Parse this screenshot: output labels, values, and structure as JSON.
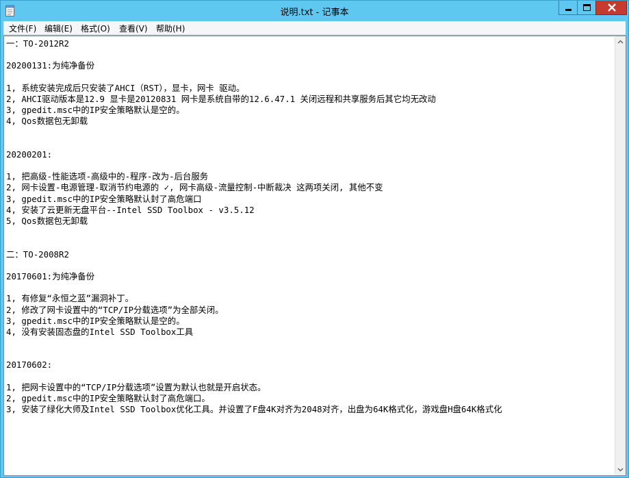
{
  "window": {
    "title": "说明.txt - 记事本",
    "app_icon": "notepad-icon"
  },
  "menu": {
    "items": [
      "文件(F)",
      "编辑(E)",
      "格式(O)",
      "查看(V)",
      "帮助(H)"
    ]
  },
  "document": {
    "lines": [
      "一：TO-2012R2",
      "",
      "20200131:为纯净备份",
      "",
      "1, 系统安装完成后只安装了AHCI（RST），显卡，网卡 驱动。",
      "2, AHCI驱动版本是12.9 显卡是20120831 网卡是系统自带的12.6.47.1 关闭远程和共享服务后其它均无改动",
      "3, gpedit.msc中的IP安全策略默认是空的。",
      "4, Qos数据包无卸载",
      "",
      "",
      "20200201:",
      "",
      "1, 把高级-性能选项-高级中的-程序-改为-后台服务",
      "2, 网卡设置-电源管理-取消节约电源的 ✓, 网卡高级-流量控制-中断裁决 这两项关闭, 其他不变",
      "3, gpedit.msc中的IP安全策略默认封了高危端口",
      "4, 安装了云更新无盘平台--Intel SSD Toolbox - v3.5.12",
      "5, Qos数据包无卸载",
      "",
      "",
      "二：TO-2008R2",
      "",
      "20170601:为纯净备份",
      "",
      "1, 有修复“永恒之蓝”漏洞补丁。",
      "2, 修改了网卡设置中的“TCP/IP分载选项”为全部关闭。",
      "3, gpedit.msc中的IP安全策略默认是空的。",
      "4, 没有安装固态盘的Intel SSD Toolbox工具",
      "",
      "",
      "20170602:",
      "",
      "1, 把网卡设置中的“TCP/IP分载选项”设置为默认也就是开启状态。",
      "2, gpedit.msc中的IP安全策略默认封了高危端口。",
      "3, 安装了绿化大师及Intel SSD Toolbox优化工具。并设置了F盘4K对齐为2048对齐，出盘为64K格式化，游戏盘H盘64K格式化"
    ]
  },
  "colors": {
    "titlebar": "#5fc8f0",
    "close_button": "#c73a2f",
    "menubar": "#f5f6f7",
    "editor_bg": "#ffffff"
  }
}
